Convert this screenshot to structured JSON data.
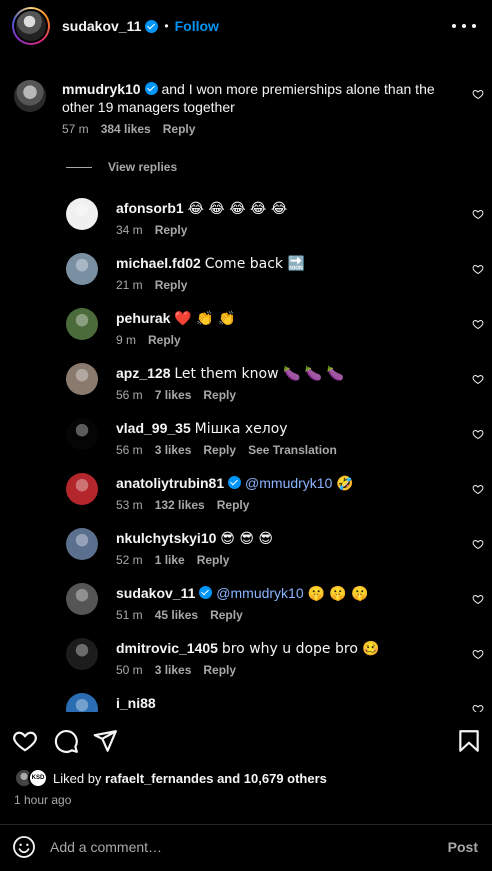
{
  "header": {
    "username": "sudakov_11",
    "separator": "•",
    "follow_label": "Follow"
  },
  "main_comment": {
    "username": "mmudryk10",
    "text": "and I won more premierships alone than the other 19 managers together",
    "time": "57 m",
    "likes": "384 likes",
    "reply_label": "Reply"
  },
  "view_replies_label": "View replies",
  "replies": [
    {
      "username": "afonsorb1",
      "text": "😂 😂 😂 😂 😂",
      "mention": "",
      "time": "34 m",
      "likes": "",
      "reply_label": "Reply",
      "extra": "",
      "avatar_color": "#f0f0f0"
    },
    {
      "username": "michael.fd02",
      "text": "Come back 🔜",
      "mention": "",
      "time": "21 m",
      "likes": "",
      "reply_label": "Reply",
      "extra": "",
      "avatar_color": "#7b8fa3"
    },
    {
      "username": "pehurak",
      "text": "❤️ 👏 👏",
      "mention": "",
      "time": "9 m",
      "likes": "",
      "reply_label": "Reply",
      "extra": "",
      "avatar_color": "#4c6b3a"
    },
    {
      "username": "apz_128",
      "text": "Let them know 🍆 🍆 🍆",
      "mention": "",
      "time": "56 m",
      "likes": "7 likes",
      "reply_label": "Reply",
      "extra": "",
      "avatar_color": "#8a7a6e"
    },
    {
      "username": "vlad_99_35",
      "text": "Мішка хелоу",
      "mention": "",
      "time": "56 m",
      "likes": "3 likes",
      "reply_label": "Reply",
      "extra": "See Translation",
      "avatar_color": "#050505"
    },
    {
      "username": "anatoliytrubin81",
      "text": "🤣",
      "mention": "@mmudryk10",
      "time": "53 m",
      "likes": "132 likes",
      "reply_label": "Reply",
      "extra": "",
      "avatar_color": "#b3262b",
      "verified": true
    },
    {
      "username": "nkulchytskyi10",
      "text": "😎 😎 😎",
      "mention": "",
      "time": "52 m",
      "likes": "1 like",
      "reply_label": "Reply",
      "extra": "",
      "avatar_color": "#5b6f8f"
    },
    {
      "username": "sudakov_11",
      "text": "🤫 🤫 🤫",
      "mention": "@mmudryk10",
      "time": "51 m",
      "likes": "45 likes",
      "reply_label": "Reply",
      "extra": "",
      "avatar_color": "#555555",
      "verified": true
    },
    {
      "username": "dmitrovic_1405",
      "text": "bro why u dope bro 🥴",
      "mention": "",
      "time": "50 m",
      "likes": "3 likes",
      "reply_label": "Reply",
      "extra": "",
      "avatar_color": "#1c1c1c"
    },
    {
      "username": "i_ni88",
      "text": "",
      "mention": "",
      "time": "",
      "likes": "",
      "reply_label": "",
      "extra": "",
      "avatar_color": "#2a6db3"
    }
  ],
  "liked_by": {
    "prefix": "Liked by",
    "user": "rafaelt_fernandes",
    "suffix": "and 10,679 others",
    "badge": "KSD"
  },
  "time_ago": "1 hour ago",
  "add_comment": {
    "placeholder": "Add a comment…",
    "post_label": "Post"
  },
  "icons": {
    "like": "heart-icon",
    "comment": "comment-icon",
    "share": "share-icon",
    "save": "bookmark-icon",
    "emoji": "smiley-icon",
    "more": "more-horizontal-icon"
  }
}
